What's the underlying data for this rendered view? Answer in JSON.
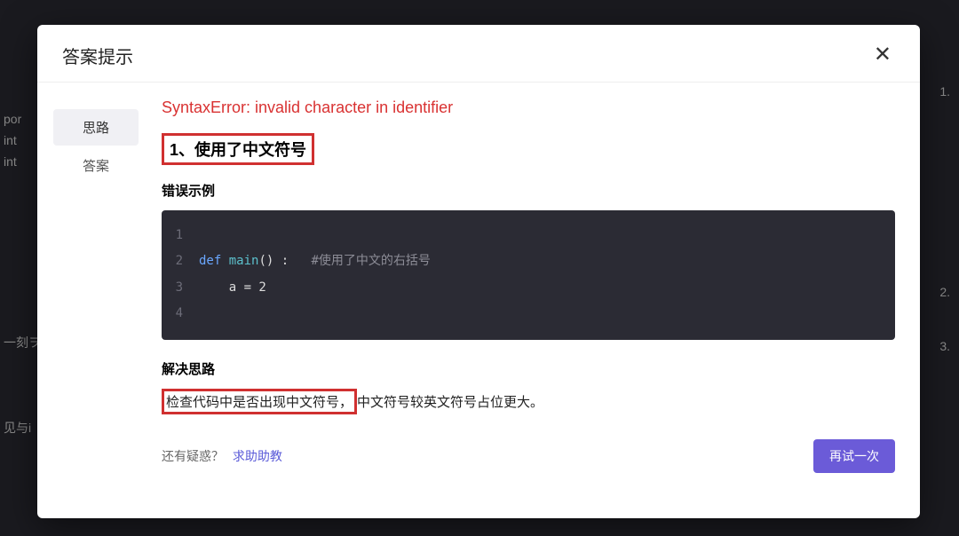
{
  "modal": {
    "title": "答案提示",
    "close_symbol": "✕"
  },
  "tabs": {
    "idea": "思路",
    "answer": "答案"
  },
  "content": {
    "error_title": "SyntaxError: invalid character in identifier",
    "heading1": "1、使用了中文符号",
    "example_label": "错误示例",
    "code": {
      "ln1": "1",
      "ln2": "2",
      "ln3": "3",
      "ln4": "4",
      "c2_kw": "def",
      "c2_fn": " main",
      "c2_rest": "() :   ",
      "c2_comment": "#使用了中文的右括号",
      "c3": "    a = 2"
    },
    "solution_label": "解决思路",
    "solution_highlight": "检查代码中是否出现中文符号，",
    "solution_rest": "中文符号较英文符号占位更大。",
    "still_q": "还有疑惑？",
    "help_link": "求助助教",
    "retry_btn": "再试一次"
  },
  "bg": {
    "l1": "por",
    "l2": "int",
    "l3": "int",
    "l4": "一刻ヲ",
    "l5": "见与i",
    "r1": "1.",
    "r2": "2.",
    "r3": "3."
  }
}
